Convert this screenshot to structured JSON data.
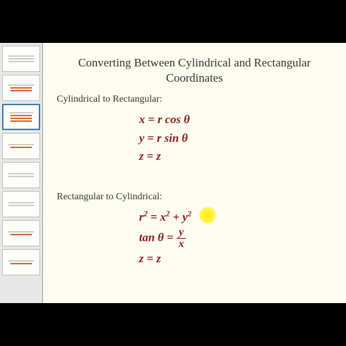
{
  "title_line1": "Converting Between Cylindrical and Rectangular",
  "title_line2": "Coordinates",
  "section1_heading": "Cylindrical to Rectangular:",
  "section2_heading": "Rectangular to Cylindrical:",
  "formulas1": {
    "f1_lhs": "x",
    "f1_eq": " = ",
    "f1_rhs": "r cos θ",
    "f2_lhs": "y",
    "f2_eq": " = ",
    "f2_rhs": "r sin θ",
    "f3_lhs": "z",
    "f3_eq": " = ",
    "f3_rhs": "z"
  },
  "formulas2": {
    "f1_pre": "r",
    "f1_sup": "2",
    "f1_mid": " = x",
    "f1_sup2": "2",
    "f1_plus": " + y",
    "f1_sup3": "2",
    "f2_lhs": "tan θ",
    "f2_eq": " = ",
    "f2_num": "y",
    "f2_den": "x",
    "f3_lhs": "z",
    "f3_eq": " = ",
    "f3_rhs": "z"
  },
  "highlight_color": "#fff000",
  "accent_color": "#8b1a1a",
  "thumbs": 8
}
